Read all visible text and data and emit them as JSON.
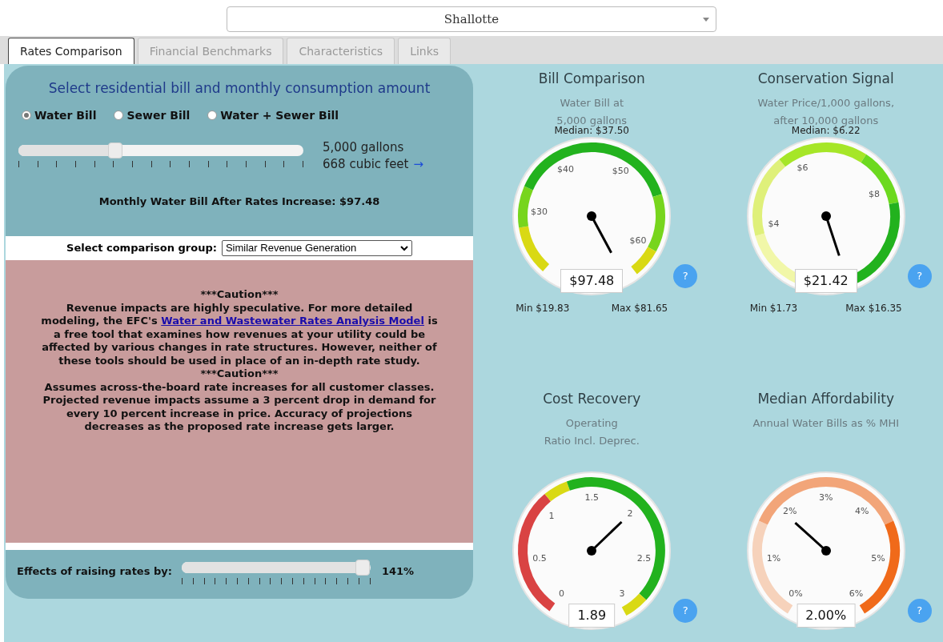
{
  "location_select": {
    "value": "Shallotte"
  },
  "tabs": [
    {
      "label": "Rates Comparison",
      "selected": true
    },
    {
      "label": "Financial Benchmarks",
      "selected": false
    },
    {
      "label": "Characteristics",
      "selected": false
    },
    {
      "label": "Links",
      "selected": false
    }
  ],
  "bill_panel": {
    "title": "Select residential bill and monthly consumption amount",
    "bill_types": [
      {
        "label": "Water Bill",
        "selected": true
      },
      {
        "label": "Sewer Bill",
        "selected": false
      },
      {
        "label": "Water + Sewer Bill",
        "selected": false
      }
    ],
    "consumption_slider": {
      "level": 0.34
    },
    "gallons": "5,000 gallons",
    "cubic_feet": "668 cubic feet",
    "arrow": "→",
    "monthly_bill": "Monthly Water Bill After Rates Increase: $97.48"
  },
  "comparison_group": {
    "label": "Select comparison group:",
    "value": "Similar Revenue Generation"
  },
  "caution": {
    "heading": "***Caution***",
    "text_before": "Revenue impacts are highly speculative. For more detailed modeling, the EFC's",
    "link": "Water and Wastewater Rates Analysis Model",
    "text_after": "is a free tool that examines how revenues at your utility could be affected by various changes in rate structures. However, neither of these tools should be used in place of an in-depth rate study.",
    "heading_2": "***Caution***",
    "text_2": "Assumes across-the-board rate increases for all customer classes. Projected revenue impacts assume a 3 percent drop in demand for every 10 percent increase in price. Accuracy of projections decreases as the proposed rate increase gets larger."
  },
  "rate_increase": {
    "label": "Effects of raising rates by:",
    "level": 0.96,
    "reading": "141%"
  },
  "gauges": [
    {
      "kind": "bill",
      "title": "Bill Comparison",
      "subtitle": [
        "Water Bill at",
        "5,000 gallons"
      ],
      "median": "Median: $37.50",
      "ticks": [
        "$30",
        "$40",
        "$50",
        "$60"
      ],
      "value": "$97.48",
      "min": "Min $19.83",
      "max": "Max $81.65",
      "help": "?"
    },
    {
      "kind": "price",
      "title": "Conservation Signal",
      "subtitle": [
        "Water Price/1,000 gallons,",
        "after 10,000 gallons"
      ],
      "median": "Median: $6.22",
      "ticks": [
        "$4",
        "$6",
        "$8"
      ],
      "value": "$21.42",
      "min": "Min $1.73",
      "max": "Max $16.35",
      "help": "?"
    },
    {
      "kind": "ratio",
      "title": "Cost Recovery",
      "subtitle": [
        "Operating",
        "Ratio Incl. Deprec."
      ],
      "ticks": [
        "0",
        "0.5",
        "1",
        "1.5",
        "2",
        "2.5",
        "3"
      ],
      "value": "1.89",
      "help": "?"
    },
    {
      "kind": "percent",
      "title": "Median Affordability",
      "subtitle": [
        "Annual Water Bills as % MHI"
      ],
      "ticks": [
        "0%",
        "1%",
        "2%",
        "3%",
        "4%",
        "5%",
        "6%"
      ],
      "value": "2.00%",
      "help": "?"
    }
  ]
}
